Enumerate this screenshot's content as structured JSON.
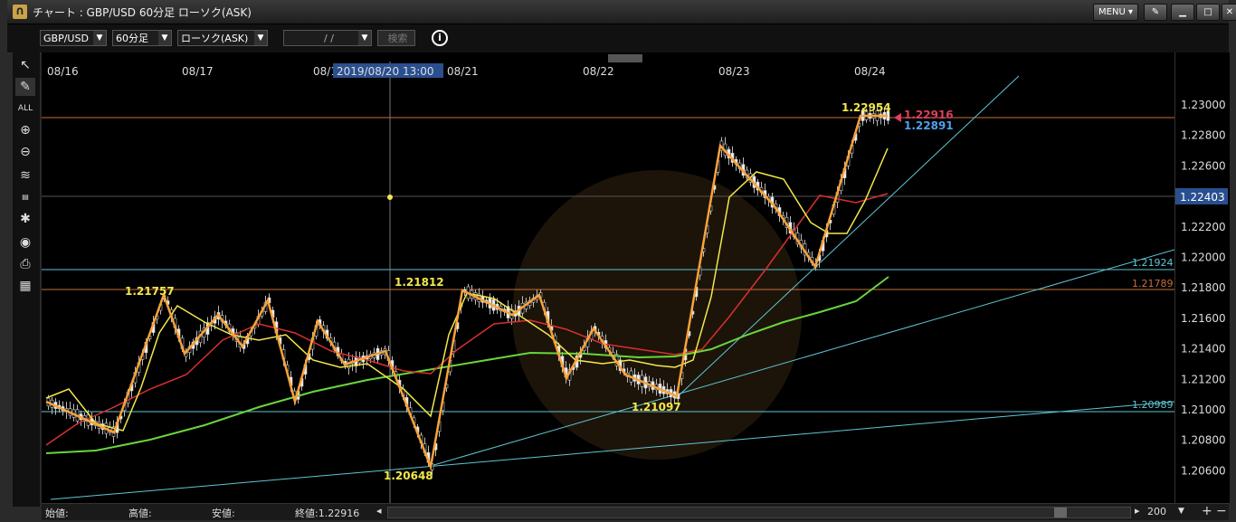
{
  "window": {
    "title": "チャート : GBP/USD 60分足 ローソク(ASK)",
    "menu_label": "MENU"
  },
  "toolbar": {
    "pair": "GBP/USD",
    "timeframe": "60分足",
    "chart_type": "ローソク(ASK)",
    "date_value": "/ /",
    "search_label": "検索"
  },
  "chart": {
    "date_labels": [
      "08/16",
      "08/17",
      "08/1",
      "08/21",
      "08/22",
      "08/23",
      "08/24"
    ],
    "crosshair_label": "2019/08/20 13:00",
    "price_ticks": [
      "1.23000",
      "1.22800",
      "1.22600",
      "1.22400",
      "1.22200",
      "1.22000",
      "1.21800",
      "1.21600",
      "1.21400",
      "1.21200",
      "1.21000",
      "1.20800",
      "1.20600"
    ],
    "annotations": [
      "1.21757",
      "1.21812",
      "1.20648",
      "1.21097",
      "1.22954"
    ],
    "bid_label": "1.22916",
    "ask_label": "1.22891",
    "current_price": "1.22403",
    "line_labels": [
      "1.21924",
      "1.21789",
      "1.20989"
    ]
  },
  "status": {
    "open_label": "始値:",
    "high_label": "高値:",
    "low_label": "安値:",
    "close_label": "終値:1.22916",
    "count": "200"
  },
  "colors": {
    "orange": "#f7a23a",
    "yellow": "#f2e84a",
    "red": "#d83030",
    "green": "#68d63c",
    "cyan": "#5fc6d4",
    "accent": "#2a4f8f"
  }
}
